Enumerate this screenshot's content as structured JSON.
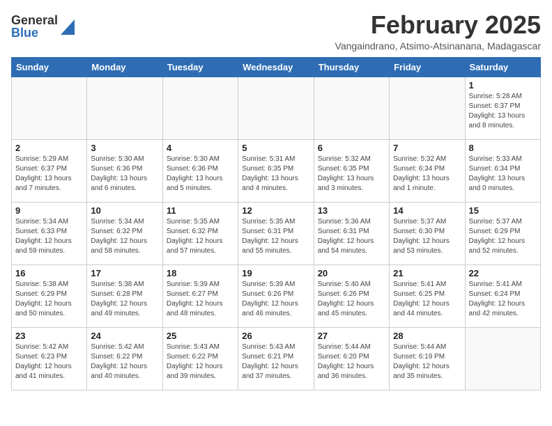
{
  "header": {
    "logo_general": "General",
    "logo_blue": "Blue",
    "month": "February 2025",
    "location": "Vangaindrano, Atsimo-Atsinanana, Madagascar"
  },
  "weekdays": [
    "Sunday",
    "Monday",
    "Tuesday",
    "Wednesday",
    "Thursday",
    "Friday",
    "Saturday"
  ],
  "weeks": [
    [
      {
        "day": "",
        "info": ""
      },
      {
        "day": "",
        "info": ""
      },
      {
        "day": "",
        "info": ""
      },
      {
        "day": "",
        "info": ""
      },
      {
        "day": "",
        "info": ""
      },
      {
        "day": "",
        "info": ""
      },
      {
        "day": "1",
        "info": "Sunrise: 5:28 AM\nSunset: 6:37 PM\nDaylight: 13 hours\nand 8 minutes."
      }
    ],
    [
      {
        "day": "2",
        "info": "Sunrise: 5:29 AM\nSunset: 6:37 PM\nDaylight: 13 hours\nand 7 minutes."
      },
      {
        "day": "3",
        "info": "Sunrise: 5:30 AM\nSunset: 6:36 PM\nDaylight: 13 hours\nand 6 minutes."
      },
      {
        "day": "4",
        "info": "Sunrise: 5:30 AM\nSunset: 6:36 PM\nDaylight: 13 hours\nand 5 minutes."
      },
      {
        "day": "5",
        "info": "Sunrise: 5:31 AM\nSunset: 6:35 PM\nDaylight: 13 hours\nand 4 minutes."
      },
      {
        "day": "6",
        "info": "Sunrise: 5:32 AM\nSunset: 6:35 PM\nDaylight: 13 hours\nand 3 minutes."
      },
      {
        "day": "7",
        "info": "Sunrise: 5:32 AM\nSunset: 6:34 PM\nDaylight: 13 hours\nand 1 minute."
      },
      {
        "day": "8",
        "info": "Sunrise: 5:33 AM\nSunset: 6:34 PM\nDaylight: 13 hours\nand 0 minutes."
      }
    ],
    [
      {
        "day": "9",
        "info": "Sunrise: 5:34 AM\nSunset: 6:33 PM\nDaylight: 12 hours\nand 59 minutes."
      },
      {
        "day": "10",
        "info": "Sunrise: 5:34 AM\nSunset: 6:32 PM\nDaylight: 12 hours\nand 58 minutes."
      },
      {
        "day": "11",
        "info": "Sunrise: 5:35 AM\nSunset: 6:32 PM\nDaylight: 12 hours\nand 57 minutes."
      },
      {
        "day": "12",
        "info": "Sunrise: 5:35 AM\nSunset: 6:31 PM\nDaylight: 12 hours\nand 55 minutes."
      },
      {
        "day": "13",
        "info": "Sunrise: 5:36 AM\nSunset: 6:31 PM\nDaylight: 12 hours\nand 54 minutes."
      },
      {
        "day": "14",
        "info": "Sunrise: 5:37 AM\nSunset: 6:30 PM\nDaylight: 12 hours\nand 53 minutes."
      },
      {
        "day": "15",
        "info": "Sunrise: 5:37 AM\nSunset: 6:29 PM\nDaylight: 12 hours\nand 52 minutes."
      }
    ],
    [
      {
        "day": "16",
        "info": "Sunrise: 5:38 AM\nSunset: 6:29 PM\nDaylight: 12 hours\nand 50 minutes."
      },
      {
        "day": "17",
        "info": "Sunrise: 5:38 AM\nSunset: 6:28 PM\nDaylight: 12 hours\nand 49 minutes."
      },
      {
        "day": "18",
        "info": "Sunrise: 5:39 AM\nSunset: 6:27 PM\nDaylight: 12 hours\nand 48 minutes."
      },
      {
        "day": "19",
        "info": "Sunrise: 5:39 AM\nSunset: 6:26 PM\nDaylight: 12 hours\nand 46 minutes."
      },
      {
        "day": "20",
        "info": "Sunrise: 5:40 AM\nSunset: 6:26 PM\nDaylight: 12 hours\nand 45 minutes."
      },
      {
        "day": "21",
        "info": "Sunrise: 5:41 AM\nSunset: 6:25 PM\nDaylight: 12 hours\nand 44 minutes."
      },
      {
        "day": "22",
        "info": "Sunrise: 5:41 AM\nSunset: 6:24 PM\nDaylight: 12 hours\nand 42 minutes."
      }
    ],
    [
      {
        "day": "23",
        "info": "Sunrise: 5:42 AM\nSunset: 6:23 PM\nDaylight: 12 hours\nand 41 minutes."
      },
      {
        "day": "24",
        "info": "Sunrise: 5:42 AM\nSunset: 6:22 PM\nDaylight: 12 hours\nand 40 minutes."
      },
      {
        "day": "25",
        "info": "Sunrise: 5:43 AM\nSunset: 6:22 PM\nDaylight: 12 hours\nand 39 minutes."
      },
      {
        "day": "26",
        "info": "Sunrise: 5:43 AM\nSunset: 6:21 PM\nDaylight: 12 hours\nand 37 minutes."
      },
      {
        "day": "27",
        "info": "Sunrise: 5:44 AM\nSunset: 6:20 PM\nDaylight: 12 hours\nand 36 minutes."
      },
      {
        "day": "28",
        "info": "Sunrise: 5:44 AM\nSunset: 6:19 PM\nDaylight: 12 hours\nand 35 minutes."
      },
      {
        "day": "",
        "info": ""
      }
    ]
  ]
}
